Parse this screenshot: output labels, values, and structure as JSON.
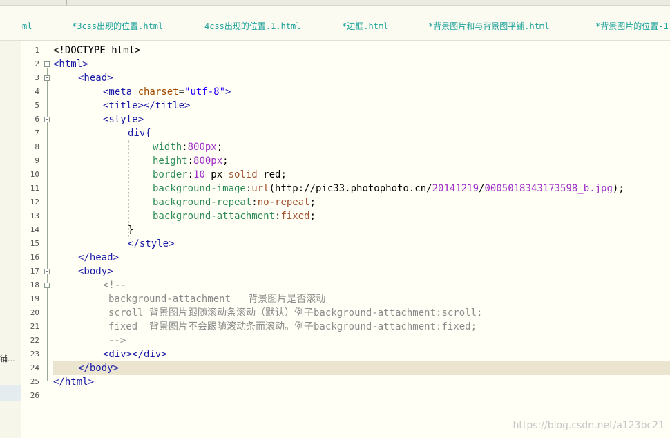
{
  "tabs": [
    {
      "label": "ml"
    },
    {
      "label": "*3css出现的位置.html"
    },
    {
      "label": "4css出现的位置.1.html"
    },
    {
      "label": "*边框.html"
    },
    {
      "label": "*背景图片和与背景图平铺.html"
    },
    {
      "label": "*背景图片的位置-1"
    }
  ],
  "left_panel": {
    "truncated_label": "铺..."
  },
  "line_numbers": [
    "1",
    "2",
    "3",
    "4",
    "5",
    "6",
    "7",
    "8",
    "9",
    "10",
    "11",
    "12",
    "13",
    "14",
    "15",
    "16",
    "17",
    "18",
    "19",
    "20",
    "21",
    "22",
    "23",
    "24",
    "25",
    "26"
  ],
  "code": {
    "l1": "<!DOCTYPE html>",
    "l2_tag": "<html>",
    "l3_tag": "<head>",
    "l4_open": "<meta ",
    "l4_attr": "charset",
    "l4_eq": "=",
    "l4_val": "\"utf-8\"",
    "l4_close": ">",
    "l5": "<title></title>",
    "l6": "<style>",
    "l7": "div{",
    "l8_prop": "width",
    "l8_val": "800px",
    "l9_prop": "height",
    "l9_val": "800px",
    "l10_prop": "border",
    "l10_num": "10",
    "l10_rest1": " px ",
    "l10_kw": "solid",
    "l10_rest2": " red;",
    "l11_prop": "background-image",
    "l11_fn": "url",
    "l11_a": "(http://pic33.photophoto.cn/",
    "l11_n1": "20141219",
    "l11_b": "/",
    "l11_n2": "0005018343173598_b.jpg",
    "l11_c": ");",
    "l12_prop": "background-repeat",
    "l12_val": "no-repeat",
    "l13_prop": "background-attachment",
    "l13_val": "fixed",
    "l14": "}",
    "l15": "</style>",
    "l16": "</head>",
    "l17": "<body>",
    "l18": "<!--",
    "l19": "background-attachment   背景图片是否滚动",
    "l20": "scroll 背景图片跟随滚动条滚动（默认）例子background-attachment:scroll;",
    "l21": "fixed  背景图片不会跟随滚动条而滚动。例子background-attachment:fixed;",
    "l22": "-->",
    "l23": "<div></div>",
    "l24": "</body>",
    "l25": "</html>"
  },
  "punct": {
    "colon": ":",
    "semi": ";"
  },
  "watermark": "https://blog.csdn.net/a123bc21"
}
